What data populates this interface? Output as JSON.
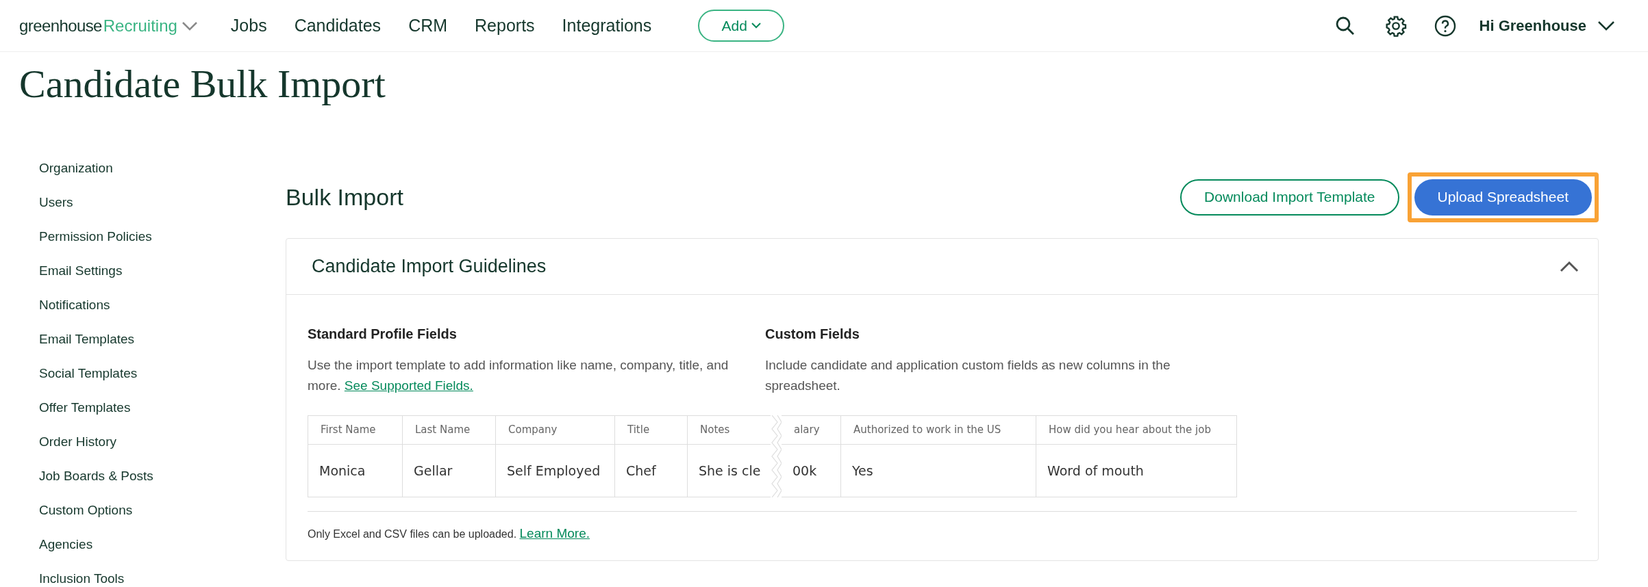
{
  "nav": {
    "logo_word": "greenhouse",
    "logo_product": "Recruiting",
    "items": [
      "Jobs",
      "Candidates",
      "CRM",
      "Reports",
      "Integrations"
    ],
    "add_button": "Add",
    "user": "Hi Greenhouse"
  },
  "page_title": "Candidate Bulk Import",
  "sidebar": {
    "items": [
      "Organization",
      "Users",
      "Permission Policies",
      "Email Settings",
      "Notifications",
      "Email Templates",
      "Social Templates",
      "Offer Templates",
      "Order History",
      "Job Boards & Posts",
      "Custom Options",
      "Agencies",
      "Inclusion Tools"
    ]
  },
  "main": {
    "title": "Bulk Import",
    "buttons": [
      {
        "label": "Download Import Template",
        "kind": "outline",
        "highlighted": false
      },
      {
        "label": "Upload Spreadsheet",
        "kind": "primary",
        "highlighted": true
      }
    ],
    "card": {
      "title": "Candidate Import Guidelines",
      "expanded": true,
      "sections": [
        {
          "heading": "Standard Profile Fields",
          "text": "Use the import template to add information like name, company, title, and more.",
          "link": "See Supported Fields."
        },
        {
          "heading": "Custom Fields",
          "text": "Include candidate and application custom fields as new columns in the spreadsheet."
        }
      ],
      "table": {
        "columns_left": [
          "First Name",
          "Last Name",
          "Company",
          "Title",
          "Notes"
        ],
        "columns_right": [
          "alary",
          "Authorized to work in the US",
          "How did you hear about the job"
        ],
        "row_left": [
          "Monica",
          "Gellar",
          "Self Employed",
          "Chef",
          "She is cle"
        ],
        "row_right": [
          "00k",
          "Yes",
          "Word of mouth"
        ]
      },
      "footer_text": "Only Excel and CSV files can be uploaded.",
      "footer_link": "Learn More."
    }
  }
}
